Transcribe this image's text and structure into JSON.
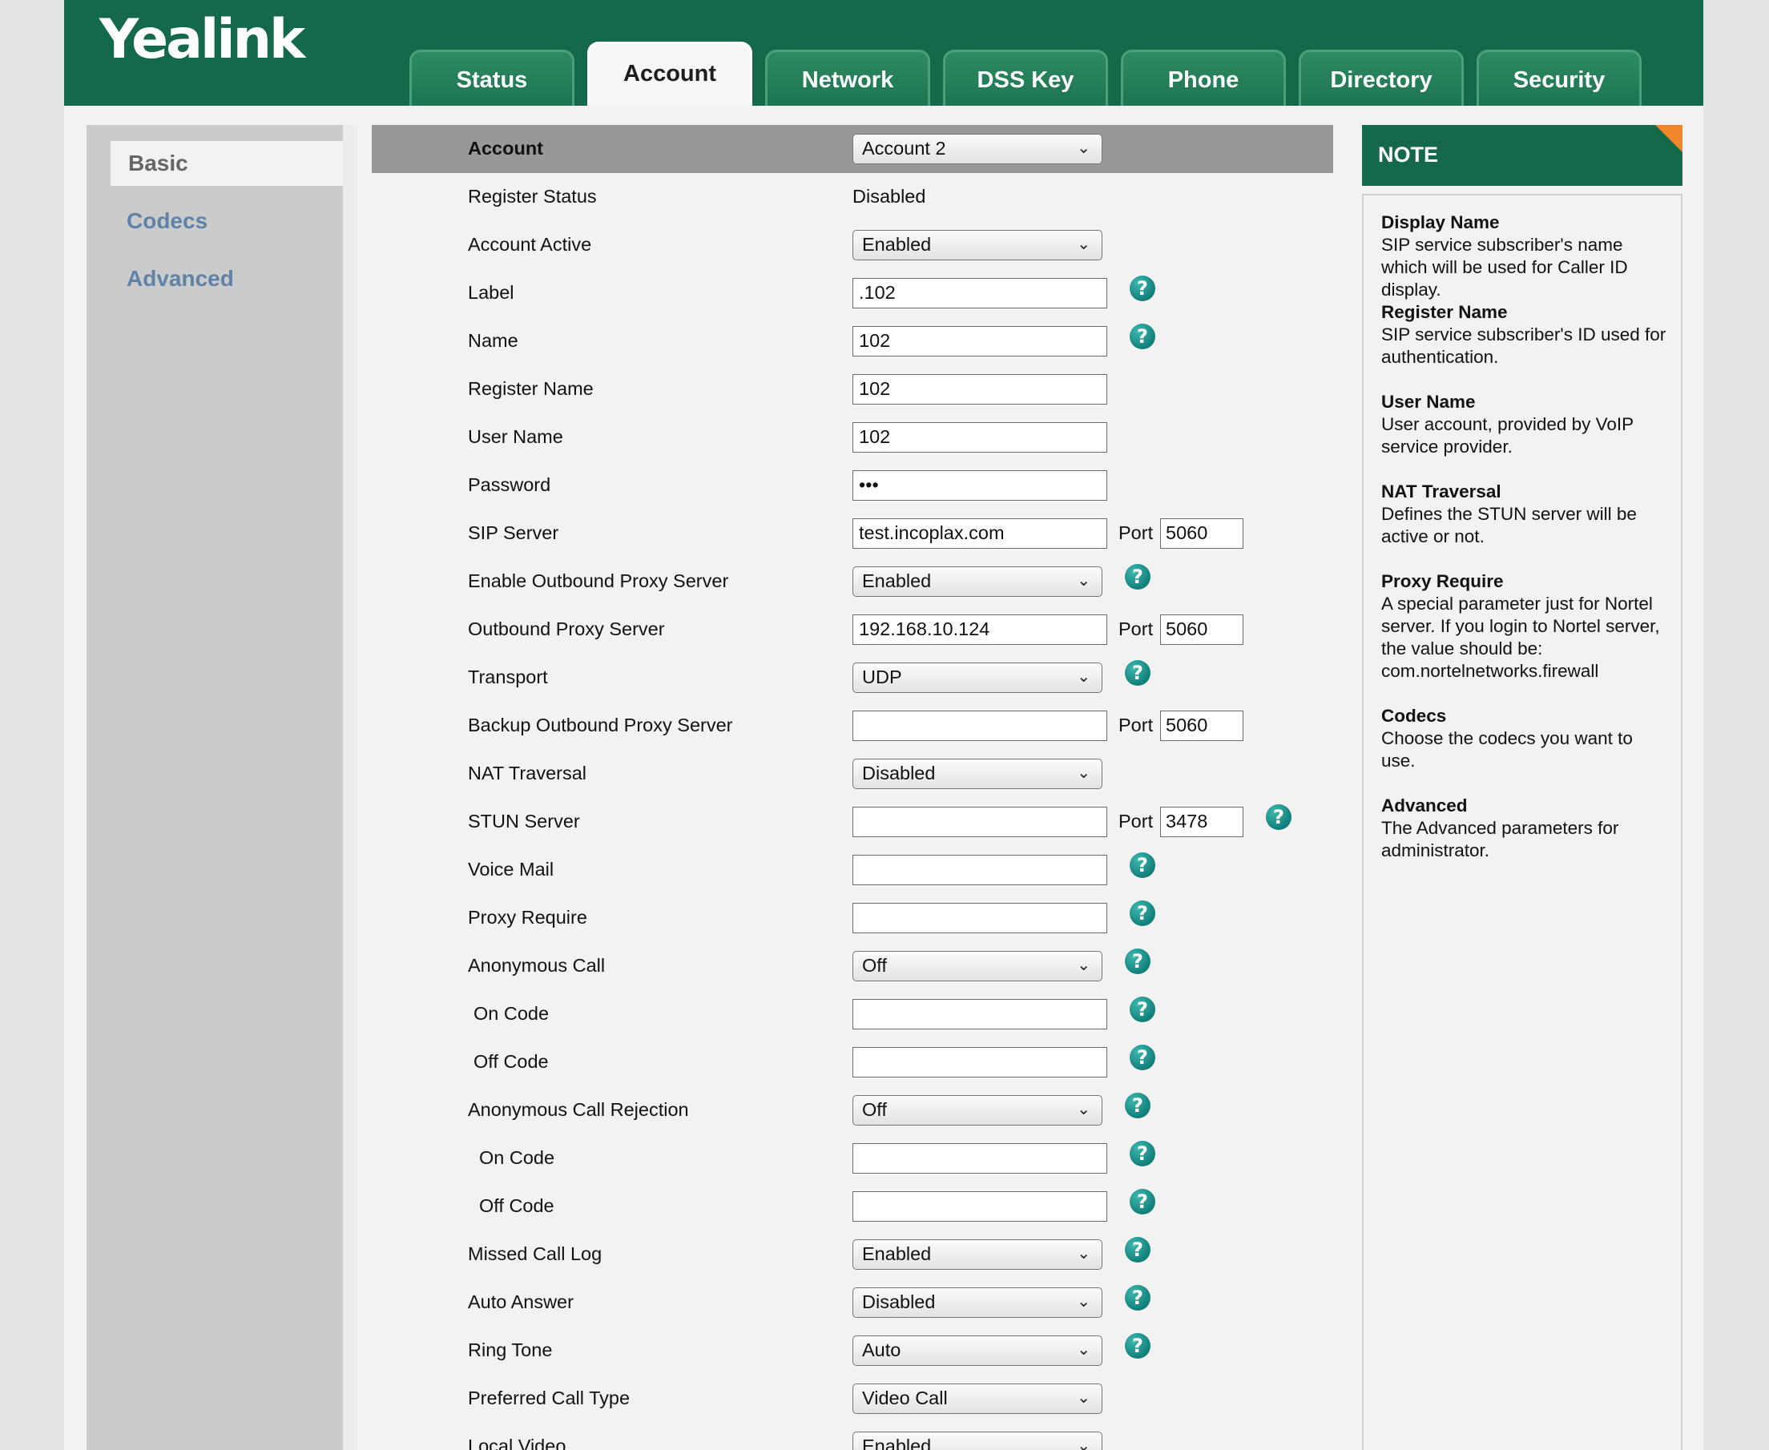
{
  "brand": "Yealink",
  "tabs": [
    "Status",
    "Account",
    "Network",
    "DSS Key",
    "Phone",
    "Directory",
    "Security"
  ],
  "active_tab": "Account",
  "sidebar": {
    "items": [
      "Basic",
      "Codecs",
      "Advanced"
    ],
    "active": "Basic"
  },
  "form": {
    "account": {
      "label": "Account",
      "value": "Account 2"
    },
    "register_status": {
      "label": "Register Status",
      "value": "Disabled"
    },
    "account_active": {
      "label": "Account Active",
      "value": "Enabled"
    },
    "label": {
      "label": "Label",
      "value": ".102"
    },
    "name": {
      "label": "Name",
      "value": "102"
    },
    "register_name": {
      "label": "Register Name",
      "value": "102"
    },
    "user_name": {
      "label": "User Name",
      "value": "102"
    },
    "password": {
      "label": "Password",
      "value": "•••"
    },
    "sip_server": {
      "label": "SIP Server",
      "value": "test.incoplax.com",
      "port_label": "Port",
      "port": "5060"
    },
    "enable_outbound_proxy": {
      "label": "Enable Outbound Proxy Server",
      "value": "Enabled"
    },
    "outbound_proxy": {
      "label": "Outbound Proxy Server",
      "value": "192.168.10.124",
      "port_label": "Port",
      "port": "5060"
    },
    "transport": {
      "label": "Transport",
      "value": "UDP"
    },
    "backup_outbound_proxy": {
      "label": "Backup Outbound Proxy Server",
      "value": "",
      "port_label": "Port",
      "port": "5060"
    },
    "nat_traversal": {
      "label": "NAT Traversal",
      "value": "Disabled"
    },
    "stun_server": {
      "label": "STUN Server",
      "value": "",
      "port_label": "Port",
      "port": "3478"
    },
    "voice_mail": {
      "label": "Voice Mail",
      "value": ""
    },
    "proxy_require": {
      "label": "Proxy Require",
      "value": ""
    },
    "anonymous_call": {
      "label": "Anonymous Call",
      "value": "Off"
    },
    "anon_on_code": {
      "label": "On Code",
      "value": ""
    },
    "anon_off_code": {
      "label": "Off Code",
      "value": ""
    },
    "anonymous_call_rejection": {
      "label": "Anonymous Call Rejection",
      "value": "Off"
    },
    "rej_on_code": {
      "label": "On Code",
      "value": ""
    },
    "rej_off_code": {
      "label": "Off Code",
      "value": ""
    },
    "missed_call_log": {
      "label": "Missed Call Log",
      "value": "Enabled"
    },
    "auto_answer": {
      "label": "Auto Answer",
      "value": "Disabled"
    },
    "ring_tone": {
      "label": "Ring Tone",
      "value": "Auto"
    },
    "preferred_call_type": {
      "label": "Preferred Call Type",
      "value": "Video Call"
    },
    "local_video": {
      "label": "Local Video",
      "value": "Enabled"
    }
  },
  "help_glyph": "?",
  "note": {
    "title": "NOTE",
    "items": [
      {
        "title": "Display Name",
        "text": "SIP service subscriber's name which will be used for Caller ID display."
      },
      {
        "title": "Register Name",
        "text": "SIP service subscriber's ID used for authentication."
      },
      {
        "title": "User Name",
        "text": "User account, provided by VoIP service provider."
      },
      {
        "title": "NAT Traversal",
        "text": "Defines the STUN server will be active or not."
      },
      {
        "title": "Proxy Require",
        "text": "A special parameter just for Nortel server. If you login to Nortel server, the value should be: com.nortelnetworks.firewall"
      },
      {
        "title": "Codecs",
        "text": "Choose the codecs you want to use."
      },
      {
        "title": "Advanced",
        "text": "The Advanced parameters for administrator."
      }
    ]
  },
  "colors": {
    "header": "#13694a",
    "accent": "#f0882b",
    "help": "#117f7a",
    "sidebar_link": "#5f82a8"
  }
}
